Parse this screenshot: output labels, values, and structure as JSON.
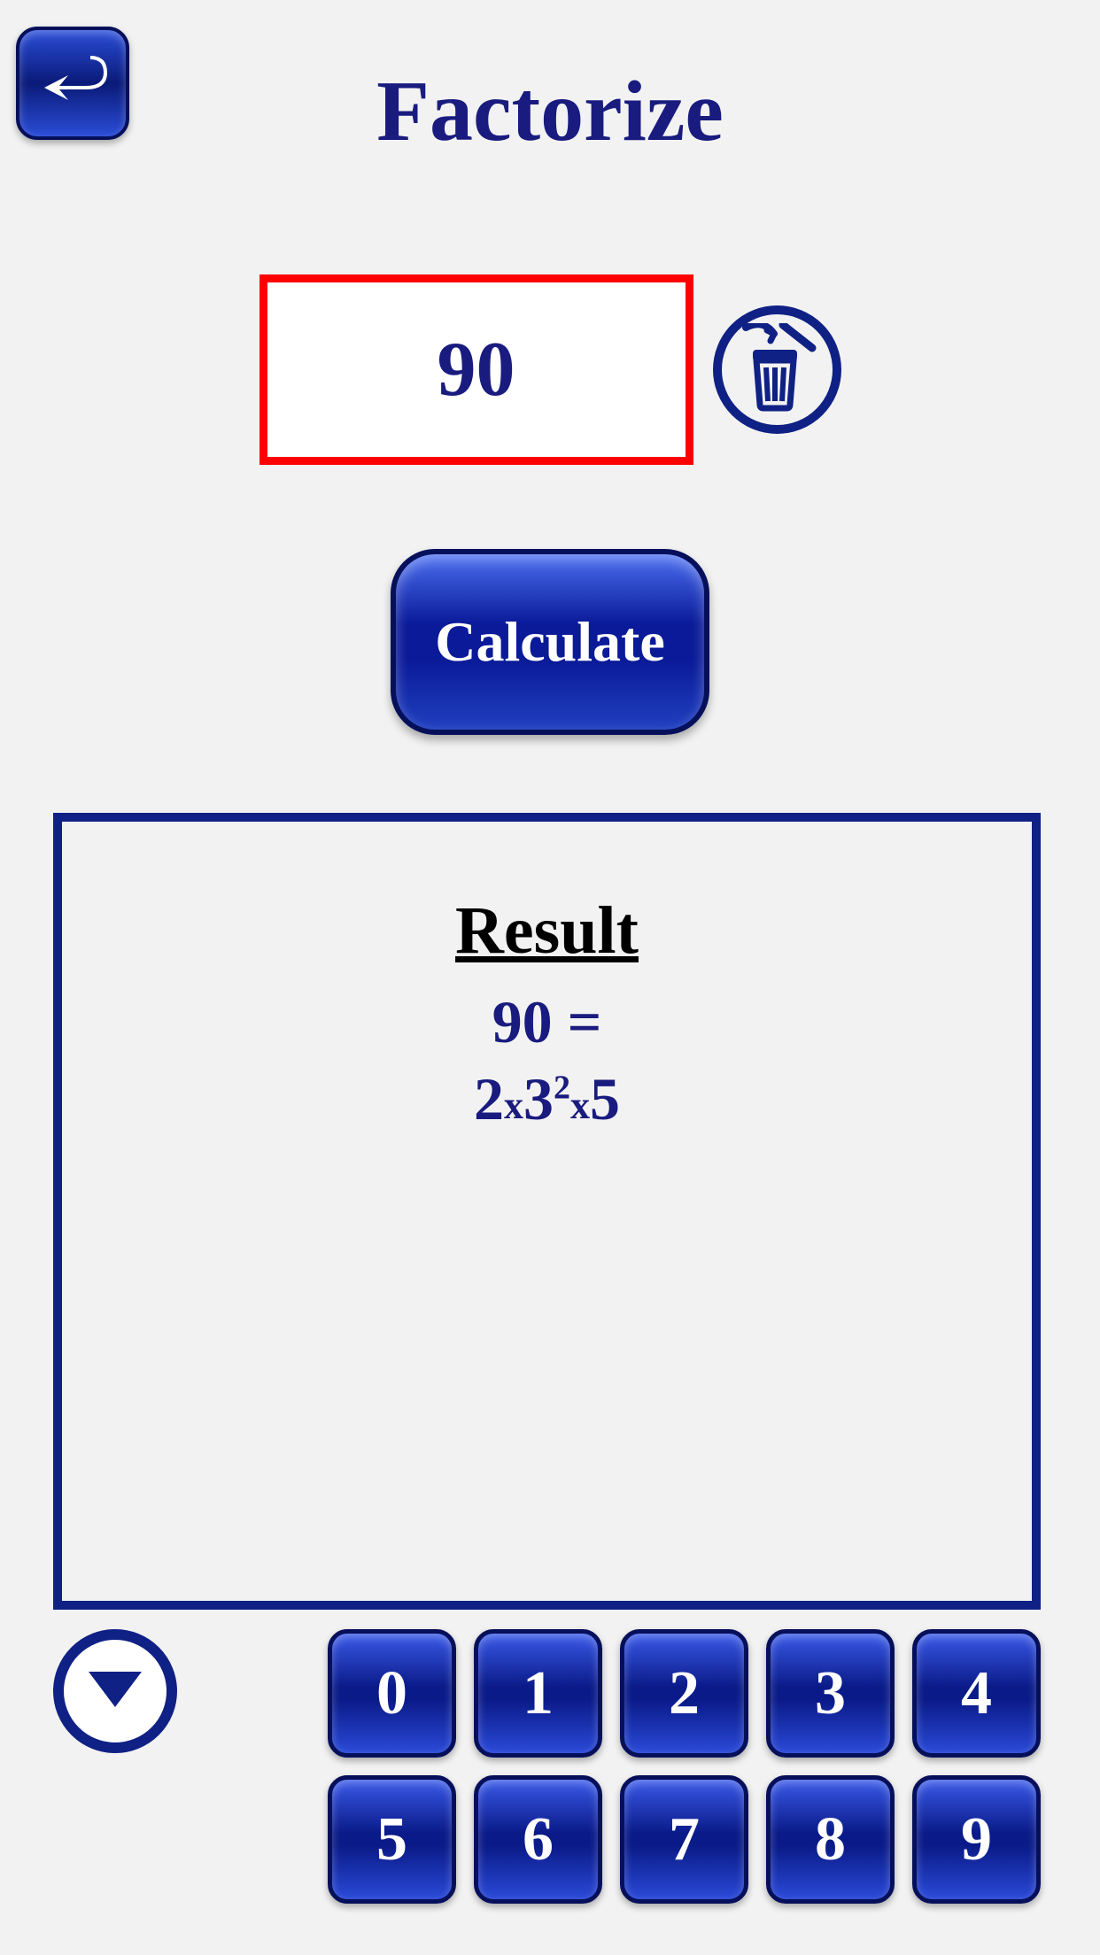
{
  "title": "Factorize",
  "input": {
    "value": "90"
  },
  "calculate_label": "Calculate",
  "result": {
    "heading": "Result",
    "equation": "90 =",
    "factors_html": "2<span class='mult'>x</span>3<sup>2</sup><span class='mult'>x</span>5"
  },
  "keypad": {
    "row1": [
      "0",
      "1",
      "2",
      "3",
      "4"
    ],
    "row2": [
      "5",
      "6",
      "7",
      "8",
      "9"
    ]
  }
}
